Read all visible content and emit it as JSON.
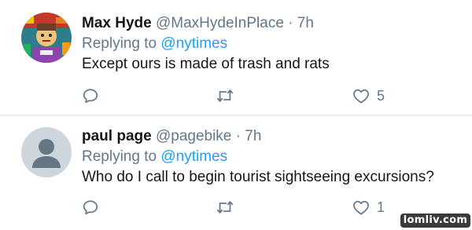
{
  "tweets": [
    {
      "name": "Max Hyde",
      "handle": "@MaxHydeInPlace",
      "separator": "·",
      "time": "7h",
      "replying_prefix": "Replying to",
      "replying_to": "@nytimes",
      "text": "Except ours is made of trash and rats",
      "likes": "5",
      "avatar_icon": "cartoon-character-avatar"
    },
    {
      "name": "paul page",
      "handle": "@pagebike",
      "separator": "·",
      "time": "7h",
      "replying_prefix": "Replying to",
      "replying_to": "@nytimes",
      "text": "Who do I call to begin tourist sightseeing excursions?",
      "likes": "1",
      "avatar_icon": "default-person-avatar"
    }
  ],
  "icons": {
    "reply": "speech-bubble-icon",
    "retweet": "retweet-icon",
    "like": "heart-icon"
  },
  "colors": {
    "mention": "#1da1f2",
    "meta": "#657786",
    "divider": "#e6ecf0"
  },
  "watermark": "lomliv.com"
}
